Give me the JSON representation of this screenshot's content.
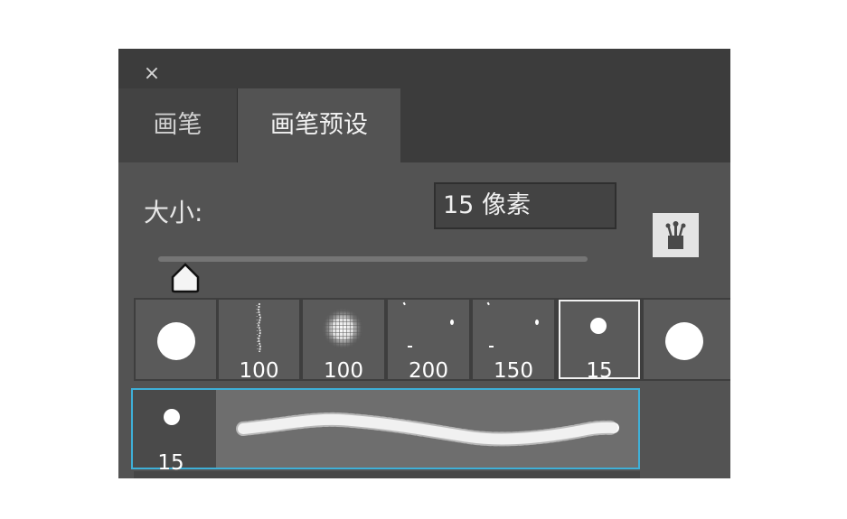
{
  "panel": {
    "close_icon": "×"
  },
  "tabs": [
    {
      "label": "画笔"
    },
    {
      "label": "画笔预设"
    }
  ],
  "size": {
    "label": "大小:",
    "value": "15 像素",
    "slider_fraction": 0.03
  },
  "presets": [
    {
      "label": "",
      "icon": "hard-round-brush"
    },
    {
      "label": "100",
      "icon": "grainy-line-brush"
    },
    {
      "label": "100",
      "icon": "soft-textured-brush"
    },
    {
      "label": "200",
      "icon": "scattered-dots-brush"
    },
    {
      "label": "150",
      "icon": "scattered-dots-brush"
    },
    {
      "label": "15",
      "icon": "small-round-brush",
      "selected": true
    },
    {
      "label": "",
      "icon": "hard-round-brush"
    }
  ],
  "stroke_preview": {
    "label": "15",
    "icon": "brush-stroke-preview"
  },
  "colors": {
    "panel_bg": "#535353",
    "selection_accent": "#3eb0d8"
  }
}
